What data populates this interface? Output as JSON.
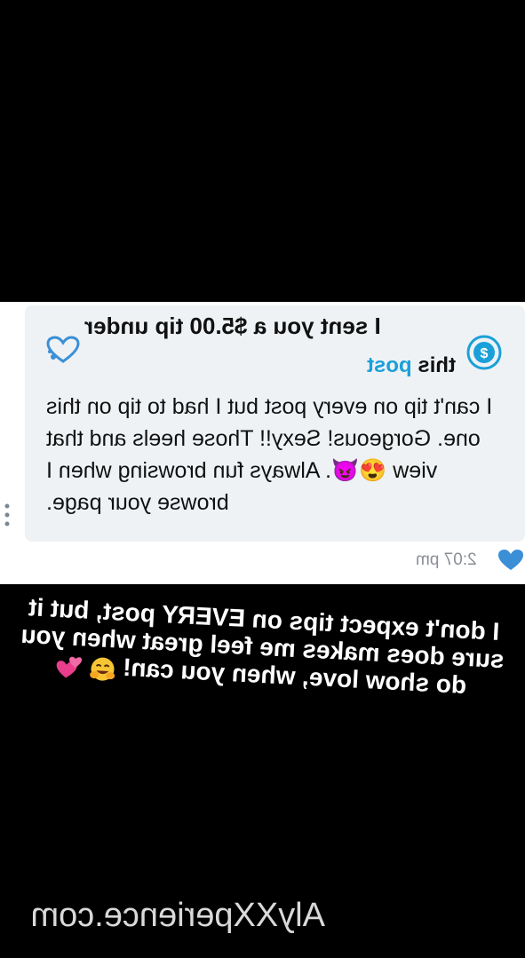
{
  "tip": {
    "title": "I sent you a $5.00 tip under",
    "link_prefix": "this ",
    "link": "post",
    "message": "I can't tip on every post but I had to tip on this one. Gorgeous! Sexy!! Those heels and that view 😍😈. Always fun browsing when I browse your page.",
    "timestamp": "2:07 pm"
  },
  "caption": {
    "text": "I don't expect tips on EVERY post, but it sure does makes me feel great when you do show love, when you can!",
    "emojis": [
      "hugging-face",
      "two-hearts"
    ]
  },
  "watermark": "AlyXXperience.com",
  "colors": {
    "link": "#1aa0d8",
    "bubble": "#eef2f5",
    "heart": "#3b8fd6"
  }
}
